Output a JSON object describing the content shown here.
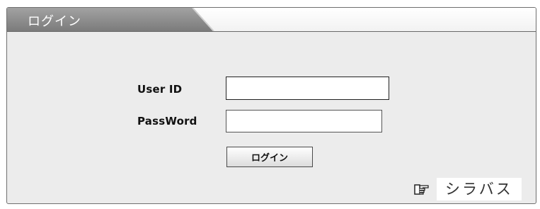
{
  "header": {
    "title": "ログイン"
  },
  "form": {
    "user_id_label": "User ID",
    "user_id_value": "",
    "password_label": "PassWord",
    "password_value": "",
    "submit_label": "ログイン"
  },
  "links": {
    "syllabus_label": "シラバス",
    "syllabus_icon": "pointing-hand-icon"
  },
  "colors": {
    "tab_bg": "#8a8a8a",
    "panel_bg": "#ececec",
    "border": "#6f6f6f"
  }
}
